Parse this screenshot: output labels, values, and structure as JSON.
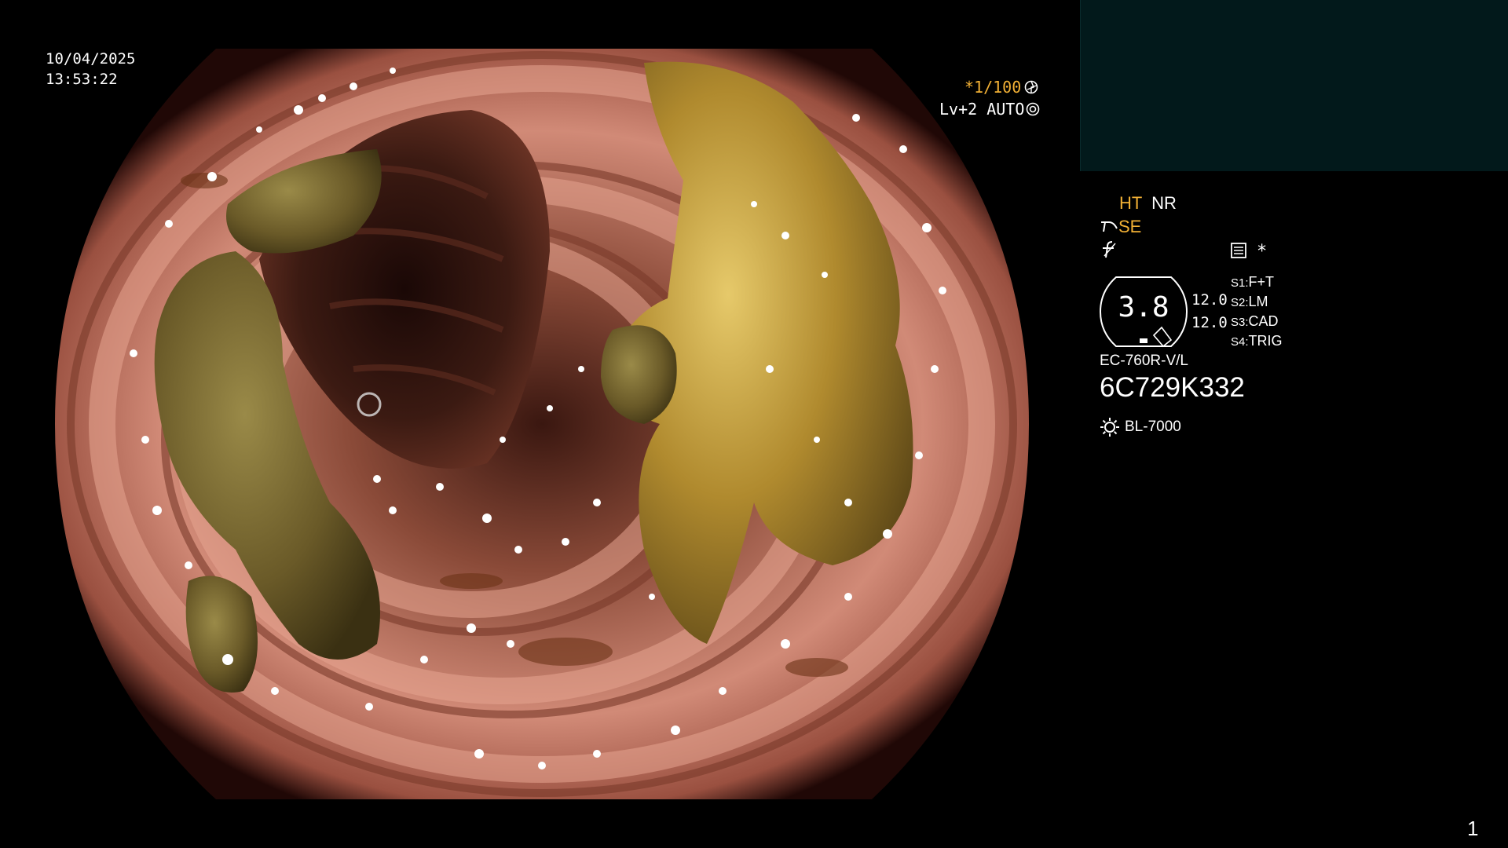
{
  "datetime": {
    "date": "10/04/2025",
    "time": "13:53:22"
  },
  "overlay": {
    "shutter": "*1/100",
    "shutter_icon": "aperture-icon",
    "level": "Lv+2 AUTO",
    "level_icon": "iris-icon"
  },
  "settings": {
    "ht": "HT",
    "nr": "NR",
    "se": "SE",
    "se_icon": "tool-icon",
    "f_icon": "enhancement-icon",
    "memo_icon": "memo-icon",
    "star": "*"
  },
  "gauge": {
    "value": "3.8",
    "top_value": "12.0",
    "bottom_value": "12.0"
  },
  "switches": [
    {
      "key": "S1:",
      "value": "F+T"
    },
    {
      "key": "S2:",
      "value": "LM"
    },
    {
      "key": "S3:",
      "value": "CAD"
    },
    {
      "key": "S4:",
      "value": "TRIG"
    }
  ],
  "device": {
    "model": "EC-760R-V/L",
    "serial": "6C729K332",
    "light_source": "BL-7000",
    "light_icon": "sun-icon"
  },
  "page_number": "1",
  "colors": {
    "accent_yellow": "#f3b135",
    "panel": "#02191b",
    "mucosa": "#c98573",
    "debris": "#a8872e"
  }
}
